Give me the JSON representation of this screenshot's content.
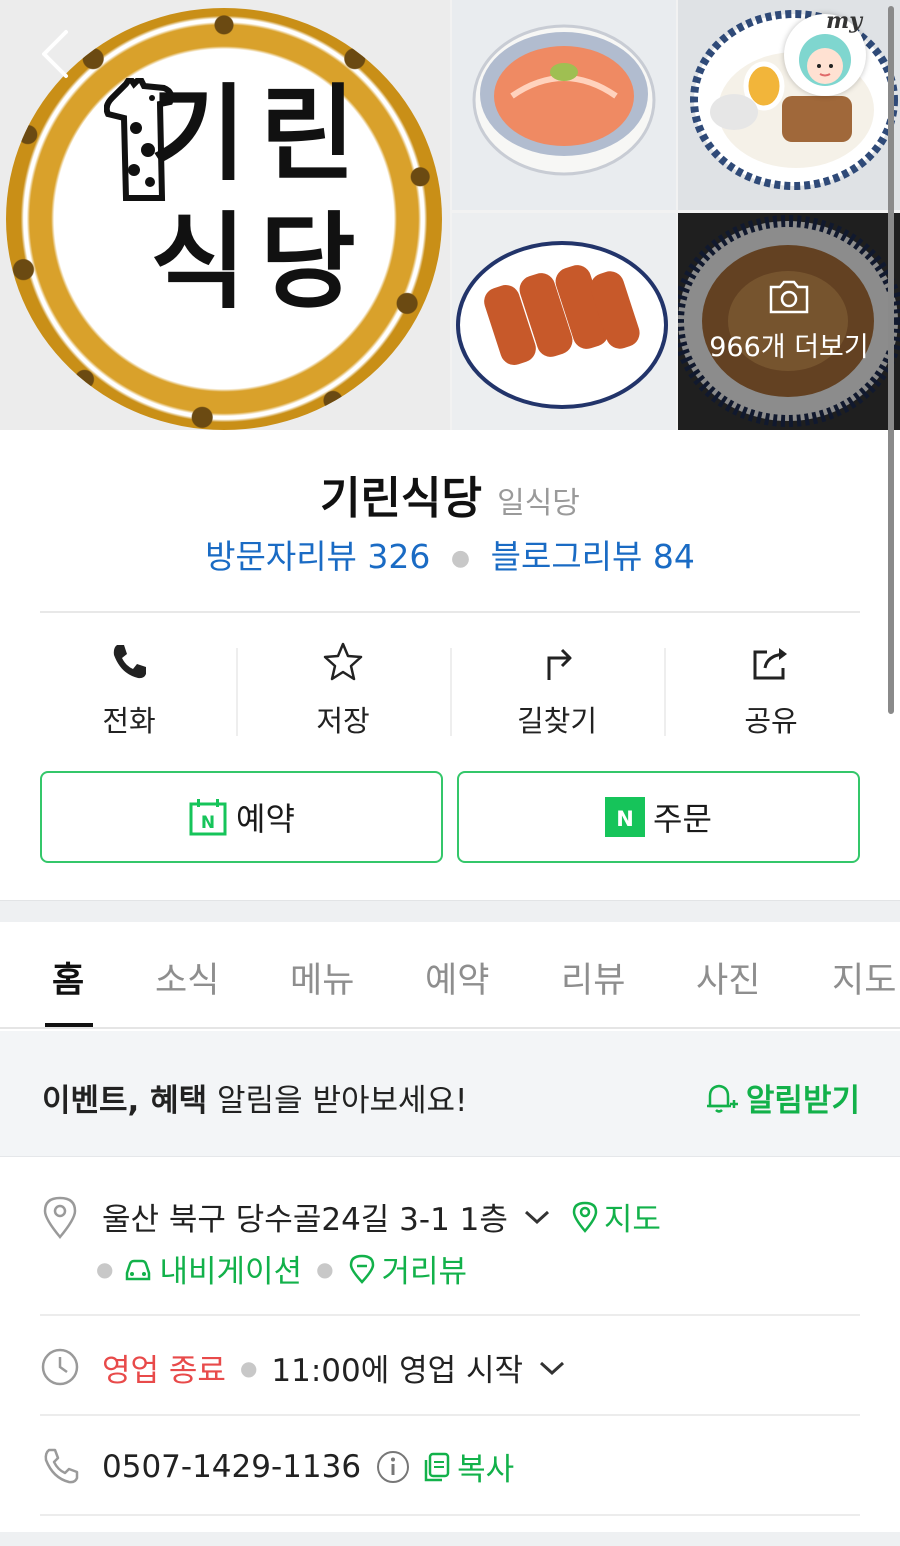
{
  "header": {
    "logo_text": "기린\n식당",
    "photo_count_label": "966개 더보기",
    "my_label": "my"
  },
  "place": {
    "name": "기린식당",
    "category": "일식당",
    "visitor_reviews": "방문자리뷰 326",
    "blog_reviews": "블로그리뷰 84"
  },
  "actions": [
    {
      "label": "전화",
      "icon": "phone-icon"
    },
    {
      "label": "저장",
      "icon": "star-icon"
    },
    {
      "label": "길찾기",
      "icon": "directions-icon"
    },
    {
      "label": "공유",
      "icon": "share-icon"
    }
  ],
  "buttons": {
    "reserve": "예약",
    "order": "주문"
  },
  "tabs": [
    "홈",
    "소식",
    "메뉴",
    "예약",
    "리뷰",
    "사진",
    "지도"
  ],
  "alert": {
    "bold": "이벤트, 혜택",
    "rest": " 알림을 받아보세요!",
    "action": "알림받기"
  },
  "address": {
    "text": "울산 북구 당수골24길 3-1 1층",
    "map": "지도",
    "navigation": "내비게이션",
    "street_view": "거리뷰"
  },
  "hours": {
    "status": "영업 종료",
    "next": "11:00에 영업 시작"
  },
  "phone": {
    "number": "0507-1429-1136",
    "copy": "복사"
  },
  "colors": {
    "brand_green": "#12b14a",
    "link_blue": "#1a6bc4",
    "closed_red": "#e84a4a"
  }
}
